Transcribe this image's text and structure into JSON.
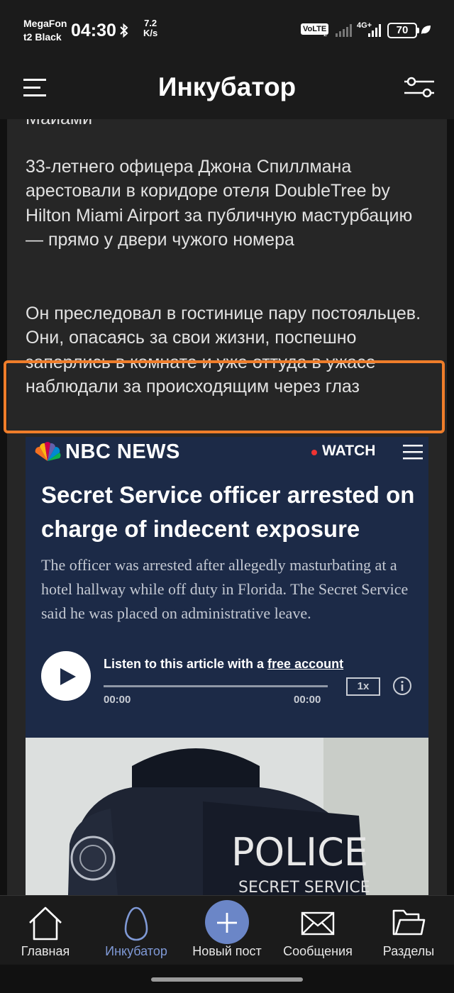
{
  "status_bar": {
    "carrier_line1": "MegaFon",
    "carrier_line2": "t2 Black",
    "time": "04:30",
    "speed_value": "7.2",
    "speed_unit": "K/s",
    "volte": "VoLTE",
    "volte_sub": "2",
    "network": "4G+",
    "battery": "70",
    "icons": [
      "bluetooth-icon",
      "signal-icon",
      "battery-icon",
      "leaf-icon"
    ]
  },
  "header": {
    "title": "Инкубатор",
    "menu_icon": "hamburger-icon",
    "filter_icon": "filter-sliders-icon"
  },
  "article": {
    "cut_line": "Майами",
    "paragraph1": "33-летнего офицера Джона Спиллмана арестовали в коридоре отеля DoubleTree by Hilton Miami Airport за публичную мастурбацию — прямо у двери чужого номера",
    "paragraph2": "Он преследовал в гостинице пару постояльцев. Они, опасаясь за свои жизни, поспешно заперлись в комнате и уже оттуда в ужасе наблюдали за происходящим через глаз",
    "highlight_color": "#ef7d2a"
  },
  "embed": {
    "brand": "NBC NEWS",
    "watch": "WATCH",
    "headline": "Secret Service officer arrested on charge of indecent exposure",
    "dek": "The officer was arrested after allegedly masturbating at a hotel hallway while off duty in Florida. The Secret Service said he was placed on administrative leave.",
    "listen_prefix": "Listen to this article with a ",
    "listen_link": "free account",
    "time_start": "00:00",
    "time_end": "00:00",
    "speed": "1x",
    "photo_text_main": "POLICE",
    "photo_text_sub": "SECRET SERVICE",
    "background_color": "#1c2a47"
  },
  "bottom_nav": {
    "items": [
      {
        "label": "Главная",
        "icon": "home-icon"
      },
      {
        "label": "Инкубатор",
        "icon": "egg-icon"
      },
      {
        "label": "Новый пост",
        "icon": "plus-icon"
      },
      {
        "label": "Сообщения",
        "icon": "envelope-icon"
      },
      {
        "label": "Разделы",
        "icon": "folder-icon"
      }
    ],
    "active_index": 1,
    "active_color": "#7f99d6",
    "accent_color": "#6b86c7"
  }
}
